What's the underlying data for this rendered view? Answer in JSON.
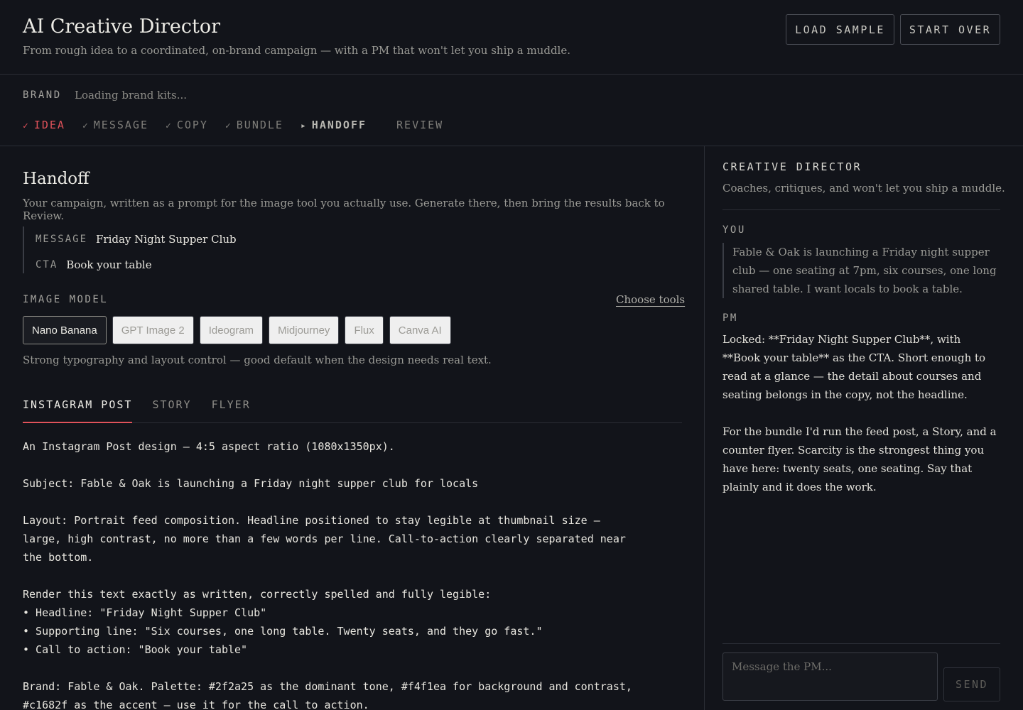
{
  "header": {
    "title": "AI Creative Director",
    "subtitle": "From rough idea to a coordinated, on-brand campaign — with a PM that won't let you ship a muddle.",
    "load_sample": "LOAD SAMPLE",
    "start_over": "START OVER"
  },
  "brand": {
    "label": "BRAND",
    "status": "Loading brand kits..."
  },
  "steps": [
    {
      "label": "IDEA",
      "glyph": "✓"
    },
    {
      "label": "MESSAGE",
      "glyph": "✓"
    },
    {
      "label": "COPY",
      "glyph": "✓"
    },
    {
      "label": "BUNDLE",
      "glyph": "✓"
    },
    {
      "label": "HANDOFF",
      "glyph": "▸"
    },
    {
      "label": "REVIEW",
      "glyph": ""
    }
  ],
  "handoff": {
    "title": "Handoff",
    "description": "Your campaign, written as a prompt for the image tool you actually use. Generate there, then bring the results back to Review.",
    "message_key": "MESSAGE",
    "message_value": "Friday Night Supper Club",
    "cta_key": "CTA",
    "cta_value": "Book your table",
    "image_model_label": "IMAGE MODEL",
    "choose_tools": "Choose tools",
    "models": [
      "Nano Banana",
      "GPT Image 2",
      "Ideogram",
      "Midjourney",
      "Flux",
      "Canva AI"
    ],
    "selected_model": "Nano Banana",
    "model_note": "Strong typography and layout control — good default when the design needs real text.",
    "tabs": [
      "INSTAGRAM POST",
      "STORY",
      "FLYER"
    ],
    "active_tab": "INSTAGRAM POST",
    "prompt": "An Instagram Post design — 4:5 aspect ratio (1080x1350px).\n\nSubject: Fable & Oak is launching a Friday night supper club for locals\n\nLayout: Portrait feed composition. Headline positioned to stay legible at thumbnail size —\nlarge, high contrast, no more than a few words per line. Call-to-action clearly separated near\nthe bottom.\n\nRender this text exactly as written, correctly spelled and fully legible:\n• Headline: \"Friday Night Supper Club\"\n• Supporting line: \"Six courses, one long table. Twenty seats, and they go fast.\"\n• Call to action: \"Book your table\"\n\nBrand: Fable & Oak. Palette: #2f2a25 as the dominant tone, #f4f1ea for background and contrast,\n#c1682f as the accent — use it for the call to action."
  },
  "sidebar": {
    "title": "CREATIVE DIRECTOR",
    "subtitle": "Coaches, critiques, and won't let you ship a muddle.",
    "you_label": "YOU",
    "you_message": "Fable & Oak is launching a Friday night supper club — one seating at 7pm, six courses, one long shared table. I want locals to book a table.",
    "pm_label": "PM",
    "pm_message_1": "Locked: **Friday Night Supper Club**, with **Book your table** as the CTA. Short enough to read at a glance — the detail about courses and seating belongs in the copy, not the headline.",
    "pm_message_2": "For the bundle I'd run the feed post, a Story, and a counter flyer. Scarcity is the strongest thing you have here: twenty seats, one seating. Say that plainly and it does the work.",
    "input_placeholder": "Message the PM...",
    "send": "SEND"
  },
  "colors": {
    "background": "#12141a",
    "accent": "#e0525a",
    "border": "#2a2d35"
  }
}
